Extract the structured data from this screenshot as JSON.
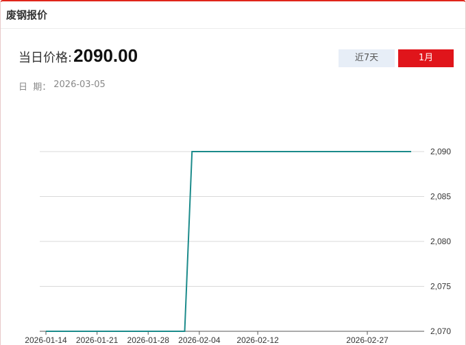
{
  "header": {
    "title": "废钢报价"
  },
  "price": {
    "label": "当日价格:",
    "value": "2090.00"
  },
  "date": {
    "label": "日  期：",
    "value": "2026-03-05"
  },
  "range_buttons": {
    "week": "近7天",
    "month": "1月",
    "active": "month"
  },
  "colors": {
    "accent": "#e0151b",
    "line": "#1a8a8a",
    "grid": "#d9d9d9"
  },
  "chart_data": {
    "type": "line",
    "x": [
      "2026-01-14",
      "2026-01-21",
      "2026-01-28",
      "2026-02-02",
      "2026-02-03",
      "2026-02-04",
      "2026-02-12",
      "2026-02-27",
      "2026-03-05"
    ],
    "series": [
      {
        "values": [
          2070,
          2070,
          2070,
          2070,
          2090,
          2090,
          2090,
          2090,
          2090
        ]
      }
    ],
    "x_ticks": [
      "2026-01-14",
      "2026-01-21",
      "2026-01-28",
      "2026-02-04",
      "2026-02-12",
      "2026-02-27"
    ],
    "y_ticks": [
      "2,090",
      "2,085",
      "2,080",
      "2,075",
      "2,070"
    ],
    "ylim": [
      2070,
      2090
    ],
    "y_axis_side": "right",
    "grid": true
  }
}
